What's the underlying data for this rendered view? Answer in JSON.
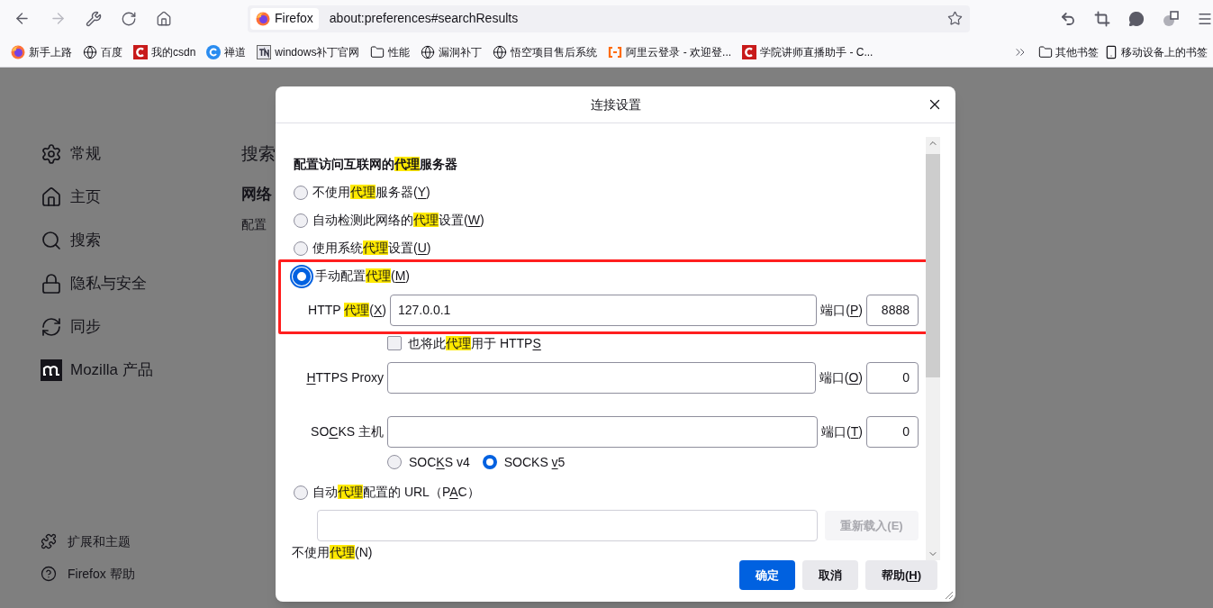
{
  "toolbar": {
    "site_label": "Firefox",
    "url": "about:preferences#searchResults"
  },
  "bookmarks": [
    {
      "label": "新手上路",
      "kind": "firefox"
    },
    {
      "label": "百度",
      "kind": "globe"
    },
    {
      "label": "我的csdn",
      "kind": "red"
    },
    {
      "label": "禅道",
      "kind": "blue"
    },
    {
      "label": "windows补丁官网",
      "kind": "tile"
    },
    {
      "label": "性能",
      "kind": "folder"
    },
    {
      "label": "漏洞补丁",
      "kind": "globe"
    },
    {
      "label": "悟空项目售后系统",
      "kind": "globe"
    },
    {
      "label": "阿里云登录 - 欢迎登...",
      "kind": "orange"
    },
    {
      "label": "学院讲师直播助手 - C...",
      "kind": "red"
    }
  ],
  "bookmarks_right": [
    {
      "label": "其他书签",
      "kind": "folder"
    },
    {
      "label": "移动设备上的书签",
      "kind": "phone"
    }
  ],
  "sidebar": [
    {
      "label": "常规",
      "kind": "gear"
    },
    {
      "label": "主页",
      "kind": "home"
    },
    {
      "label": "搜索",
      "kind": "search"
    },
    {
      "label": "隐私与安全",
      "kind": "lock"
    },
    {
      "label": "同步",
      "kind": "sync"
    },
    {
      "label": "Mozilla 产品",
      "kind": "mozilla"
    }
  ],
  "sidebar_footer": [
    {
      "label": "扩展和主题",
      "kind": "puzzle"
    },
    {
      "label": "Firefox 帮助",
      "kind": "help"
    }
  ],
  "main": {
    "heading": "搜索",
    "subheading": "网络",
    "text": "配置"
  },
  "dialog": {
    "title": "连接设置",
    "rows": [
      {
        "kind": "heading",
        "annotated": false,
        "parts": [
          {
            "text": "配置访问互联网的",
            "highlighted": false,
            "underlined": false
          },
          {
            "text": "代理",
            "highlighted": true,
            "underlined": false
          },
          {
            "text": "服务器",
            "highlighted": false,
            "underlined": false
          }
        ]
      },
      {
        "kind": "radio",
        "selected": false,
        "annotated": false,
        "parts": [
          {
            "text": "不使用",
            "highlighted": false,
            "underlined": false
          },
          {
            "text": "代理",
            "highlighted": true,
            "underlined": false
          },
          {
            "text": "服务器(",
            "highlighted": false,
            "underlined": false
          },
          {
            "text": "Y",
            "highlighted": false,
            "underlined": true
          },
          {
            "text": ")",
            "highlighted": false,
            "underlined": false
          }
        ]
      },
      {
        "kind": "radio",
        "selected": false,
        "annotated": false,
        "parts": [
          {
            "text": "自动检测此网络的",
            "highlighted": false,
            "underlined": false
          },
          {
            "text": "代理",
            "highlighted": true,
            "underlined": false
          },
          {
            "text": "设置(",
            "highlighted": false,
            "underlined": false
          },
          {
            "text": "W",
            "highlighted": false,
            "underlined": true
          },
          {
            "text": ")",
            "highlighted": false,
            "underlined": false
          }
        ]
      },
      {
        "kind": "radio",
        "selected": false,
        "annotated": false,
        "parts": [
          {
            "text": "使用系统",
            "highlighted": false,
            "underlined": false
          },
          {
            "text": "代理",
            "highlighted": true,
            "underlined": false
          },
          {
            "text": "设置(",
            "highlighted": false,
            "underlined": false
          },
          {
            "text": "U",
            "highlighted": false,
            "underlined": true
          },
          {
            "text": ")",
            "highlighted": false,
            "underlined": false
          }
        ]
      },
      {
        "kind": "radio",
        "selected": true,
        "annotated": true,
        "parts": [
          {
            "text": "手动配置",
            "highlighted": false,
            "underlined": false
          },
          {
            "text": "代理",
            "highlighted": true,
            "underlined": false
          },
          {
            "text": "(",
            "highlighted": false,
            "underlined": false
          },
          {
            "text": "M",
            "highlighted": false,
            "underlined": true
          },
          {
            "text": ")",
            "highlighted": false,
            "underlined": false
          }
        ]
      },
      {
        "kind": "host_port",
        "annotated": true,
        "value": "127.0.0.1",
        "port": "8888",
        "parts": [
          {
            "text": "HTTP ",
            "highlighted": false,
            "underlined": false
          },
          {
            "text": "代理",
            "highlighted": true,
            "underlined": false
          },
          {
            "text": "(",
            "highlighted": false,
            "underlined": false
          },
          {
            "text": "X",
            "highlighted": false,
            "underlined": true
          },
          {
            "text": ")",
            "highlighted": false,
            "underlined": false
          }
        ],
        "port_parts": [
          {
            "text": "端口(",
            "highlighted": false,
            "underlined": false
          },
          {
            "text": "P",
            "highlighted": false,
            "underlined": true
          },
          {
            "text": ")",
            "highlighted": false,
            "underlined": false
          }
        ]
      },
      {
        "kind": "checkbox",
        "checked": false,
        "annotated": false,
        "parts": [
          {
            "text": "也将此",
            "highlighted": false,
            "underlined": false
          },
          {
            "text": "代理",
            "highlighted": true,
            "underlined": false
          },
          {
            "text": "用于 HTTP",
            "highlighted": false,
            "underlined": false
          },
          {
            "text": "S",
            "highlighted": false,
            "underlined": true
          }
        ]
      },
      {
        "kind": "host_port",
        "annotated": false,
        "port": "0",
        "parts": [
          {
            "text": "H",
            "highlighted": false,
            "underlined": true
          },
          {
            "text": "TTPS Proxy",
            "highlighted": false,
            "underlined": false
          }
        ],
        "port_parts": [
          {
            "text": "端口(",
            "highlighted": false,
            "underlined": false
          },
          {
            "text": "O",
            "highlighted": false,
            "underlined": true
          },
          {
            "text": ")",
            "highlighted": false,
            "underlined": false
          }
        ]
      },
      {
        "kind": "host_port",
        "annotated": false,
        "port": "0",
        "parts": [
          {
            "text": "SO",
            "highlighted": false,
            "underlined": false
          },
          {
            "text": "C",
            "highlighted": false,
            "underlined": true
          },
          {
            "text": "KS 主机",
            "highlighted": false,
            "underlined": false
          }
        ],
        "port_parts": [
          {
            "text": "端口(",
            "highlighted": false,
            "underlined": false
          },
          {
            "text": "T",
            "highlighted": false,
            "underlined": true
          },
          {
            "text": ")",
            "highlighted": false,
            "underlined": false
          }
        ]
      },
      {
        "kind": "radio_group",
        "annotated": false,
        "options": [
          {
            "selected": false,
            "parts": [
              {
                "text": "SOC",
                "highlighted": false,
                "underlined": false
              },
              {
                "text": "K",
                "highlighted": false,
                "underlined": true
              },
              {
                "text": "S v4",
                "highlighted": false,
                "underlined": false
              }
            ]
          },
          {
            "selected": true,
            "parts": [
              {
                "text": "SOCKS ",
                "highlighted": false,
                "underlined": false
              },
              {
                "text": "v",
                "highlighted": false,
                "underlined": true
              },
              {
                "text": "5",
                "highlighted": false,
                "underlined": false
              }
            ]
          }
        ]
      },
      {
        "kind": "radio",
        "selected": false,
        "annotated": false,
        "parts": [
          {
            "text": "自动",
            "highlighted": false,
            "underlined": false
          },
          {
            "text": "代理",
            "highlighted": true,
            "underlined": false
          },
          {
            "text": "配置的 URL（P",
            "highlighted": false,
            "underlined": false
          },
          {
            "text": "A",
            "highlighted": false,
            "underlined": true
          },
          {
            "text": "C）",
            "highlighted": false,
            "underlined": false
          }
        ]
      },
      {
        "kind": "url_row",
        "annotated": false,
        "button": "重新载入(E)",
        "disabled": true
      },
      {
        "kind": "label",
        "annotated": false,
        "parts": [
          {
            "text": "不使用",
            "highlighted": false,
            "underlined": false
          },
          {
            "text": "代理",
            "highlighted": true,
            "underlined": false
          },
          {
            "text": "(N)",
            "highlighted": false,
            "underlined": false
          }
        ]
      }
    ],
    "buttons": [
      {
        "primary": true,
        "parts": [
          {
            "text": "确定",
            "highlighted": false,
            "underlined": false
          }
        ]
      },
      {
        "primary": false,
        "parts": [
          {
            "text": "取消",
            "highlighted": false,
            "underlined": false
          }
        ]
      },
      {
        "primary": false,
        "parts": [
          {
            "text": "帮助(",
            "highlighted": false,
            "underlined": false
          },
          {
            "text": "H",
            "highlighted": false,
            "underlined": true
          },
          {
            "text": ")",
            "highlighted": false,
            "underlined": false
          }
        ]
      }
    ]
  }
}
